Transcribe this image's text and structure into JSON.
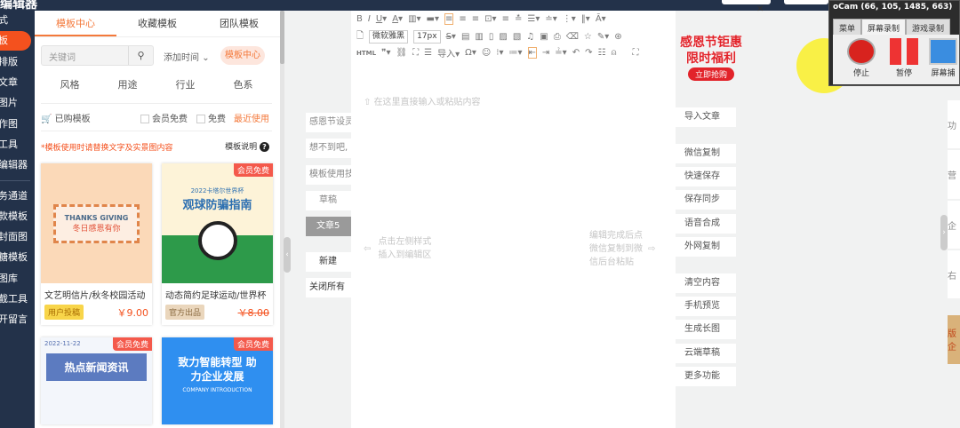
{
  "topbar": {
    "title": "编辑器"
  },
  "sidebar": {
    "items": [
      "式",
      "板",
      "排版",
      "文章",
      "图片",
      "作图",
      "工具",
      "编辑器",
      "务通道",
      "款模板",
      "封面图",
      "糖模板",
      "图库",
      "截工具",
      "开留言"
    ],
    "active": 1
  },
  "templates": {
    "tabs": [
      "模板中心",
      "收藏模板",
      "团队模板"
    ],
    "search_placeholder": "关键词",
    "sort": "添加时间",
    "center_pill": "模板中心",
    "filters": [
      "风格",
      "用途",
      "行业",
      "色系"
    ],
    "purchased": "已购模板",
    "member_free": "会员免费",
    "free": "免费",
    "recent": "最近使用",
    "notice": "*模板使用时请替换文字及实景图内容",
    "help": "模板说明",
    "cards": [
      {
        "image_title": "THANKS GIVING",
        "image_sub": "冬日感恩有你",
        "name": "文艺明信片/秋冬校园活动",
        "tag": "用户投稿",
        "price": "￥9.00",
        "badge": ""
      },
      {
        "image_title": "观球防骗指南",
        "image_sub": "2022卡塔尔世界杯",
        "name": "动态简约足球运动/世界杯",
        "tag": "官方出品",
        "price": "￥8.00",
        "badge": "会员免费"
      },
      {
        "image_title": "热点新闻资讯",
        "image_sub": "2022-11-22",
        "name": "",
        "tag": "",
        "price": "",
        "badge": "会员免费"
      },
      {
        "image_title": "致力智能转型 助力企业发展",
        "image_sub": "COMPANY INTRODUCTION",
        "name": "",
        "tag": "",
        "price": "",
        "badge": "会员免费"
      }
    ]
  },
  "articles": [
    "感恩节设灵",
    "想不到吧,",
    "模板使用技",
    "草稿",
    "文章5",
    "新建",
    "关闭所有"
  ],
  "editor": {
    "font": "微软雅黑",
    "size": "17px",
    "html": "HTML",
    "import": "导入",
    "hint_top": "在这里直接输入或粘贴内容",
    "hint_left": [
      "点击左侧样式",
      "插入到编辑区"
    ],
    "hint_right": [
      "编辑完成后点",
      "微信复制到微",
      "信后台粘贴"
    ]
  },
  "right_actions": [
    "导入文章",
    "微信复制",
    "快速保存",
    "保存同步",
    "语音合成",
    "外网复制",
    "清空内容",
    "手机预览",
    "生成长图",
    "云端草稿",
    "更多功能"
  ],
  "far_right": [
    "功",
    "营",
    "企",
    "右",
    "版企"
  ],
  "promo": {
    "line1": "感恩节钜惠",
    "line2": "限时福利",
    "button": "立即抢购"
  },
  "ocam": {
    "title": "oCam (66, 105, 1485, 663)",
    "tabs": [
      "菜单",
      "屏幕录制",
      "游戏录制"
    ],
    "buttons": [
      "停止",
      "暂停",
      "屏幕捕"
    ]
  }
}
